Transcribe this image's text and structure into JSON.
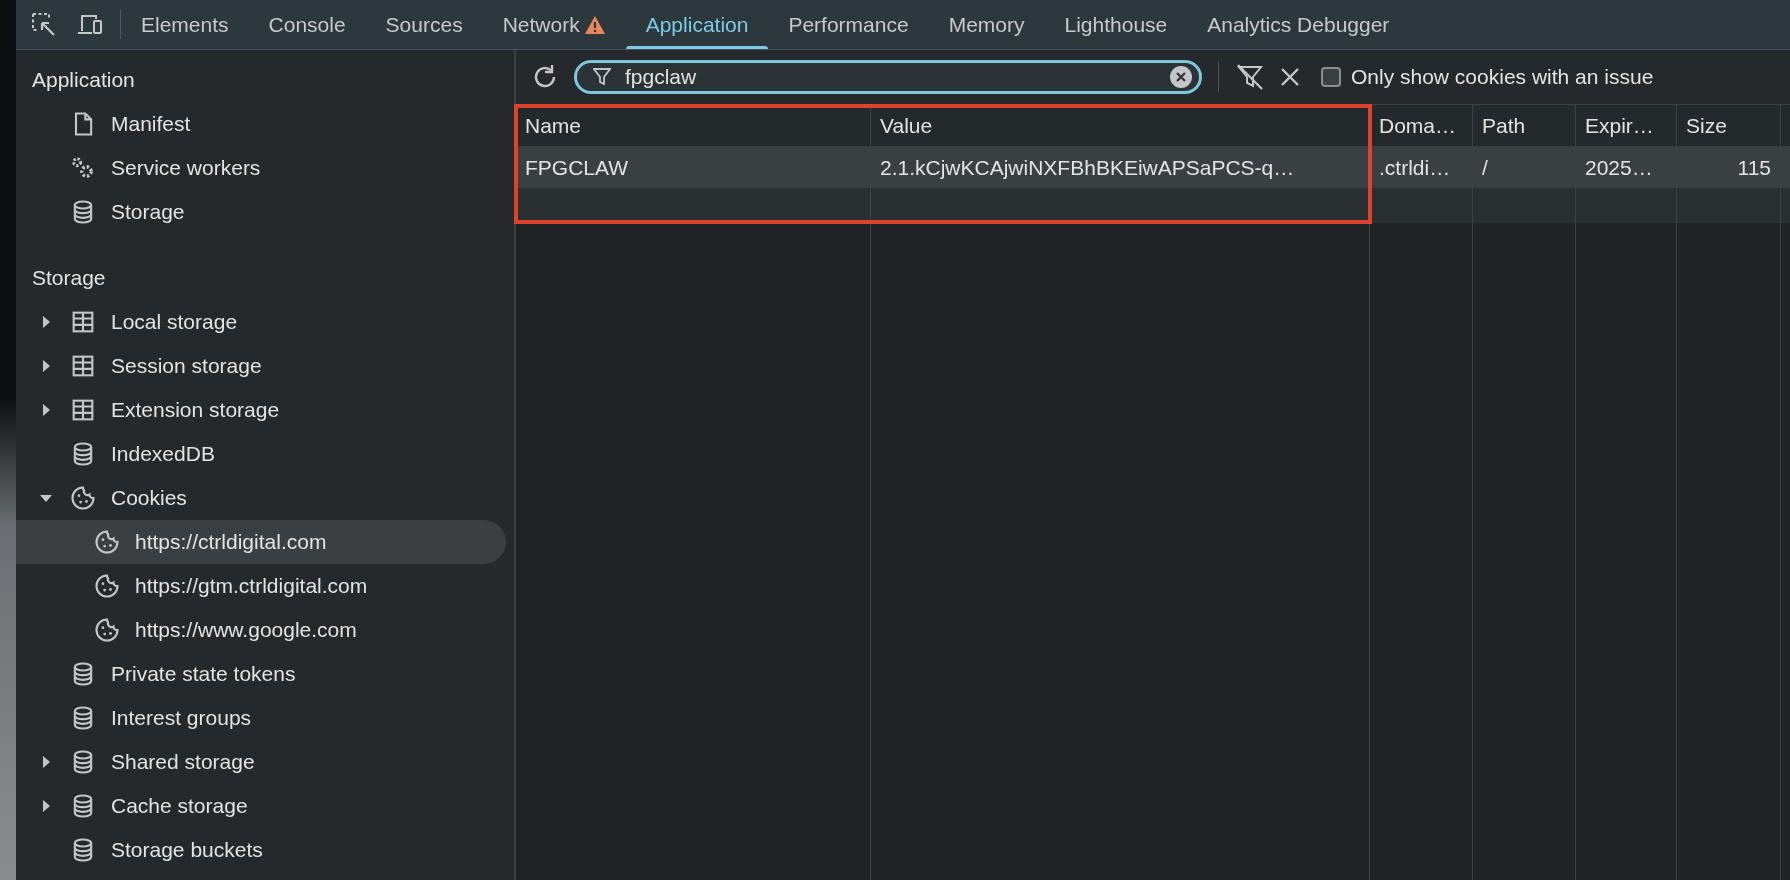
{
  "tabs": [
    {
      "label": "Elements",
      "selected": false,
      "warning": false
    },
    {
      "label": "Console",
      "selected": false,
      "warning": false
    },
    {
      "label": "Sources",
      "selected": false,
      "warning": false
    },
    {
      "label": "Network",
      "selected": false,
      "warning": true
    },
    {
      "label": "Application",
      "selected": true,
      "warning": false
    },
    {
      "label": "Performance",
      "selected": false,
      "warning": false
    },
    {
      "label": "Memory",
      "selected": false,
      "warning": false
    },
    {
      "label": "Lighthouse",
      "selected": false,
      "warning": false
    },
    {
      "label": "Analytics Debugger",
      "selected": false,
      "warning": false
    }
  ],
  "sidebar": {
    "sections": [
      {
        "title": "Application",
        "items": [
          {
            "label": "Manifest",
            "kind": "file",
            "selected": false
          },
          {
            "label": "Service workers",
            "kind": "gears",
            "selected": false
          },
          {
            "label": "Storage",
            "kind": "database",
            "selected": false
          }
        ]
      },
      {
        "title": "Storage",
        "items": [
          {
            "label": "Local storage",
            "kind": "grid",
            "expanded": false,
            "selected": false
          },
          {
            "label": "Session storage",
            "kind": "grid",
            "expanded": false,
            "selected": false
          },
          {
            "label": "Extension storage",
            "kind": "grid",
            "expanded": false,
            "selected": false
          },
          {
            "label": "IndexedDB",
            "kind": "database",
            "selected": false
          },
          {
            "label": "Cookies",
            "kind": "cookie",
            "expanded": true,
            "selected": false,
            "children": [
              {
                "label": "https://ctrldigital.com",
                "kind": "cookie",
                "selected": true
              },
              {
                "label": "https://gtm.ctrldigital.com",
                "kind": "cookie",
                "selected": false
              },
              {
                "label": "https://www.google.com",
                "kind": "cookie",
                "selected": false
              }
            ]
          },
          {
            "label": "Private state tokens",
            "kind": "database",
            "selected": false
          },
          {
            "label": "Interest groups",
            "kind": "database",
            "selected": false
          },
          {
            "label": "Shared storage",
            "kind": "database",
            "expanded": false,
            "selected": false
          },
          {
            "label": "Cache storage",
            "kind": "database",
            "expanded": false,
            "selected": false
          },
          {
            "label": "Storage buckets",
            "kind": "database",
            "selected": false
          }
        ]
      }
    ]
  },
  "toolbar": {
    "filter": {
      "value": "fpgclaw"
    },
    "issue_checkbox": {
      "label": "Only show cookies with an issue",
      "checked": false
    }
  },
  "table": {
    "columns": [
      "Name",
      "Value",
      "Doma…",
      "Path",
      "Expir…",
      "Size"
    ],
    "rows": [
      {
        "cells": [
          "FPGCLAW",
          "2.1.kCjwKCAjwiNXFBhBKEiwAPSaPCS-q…",
          ".ctrldi…",
          "/",
          "2025…",
          "115"
        ],
        "selected": true
      }
    ]
  }
}
